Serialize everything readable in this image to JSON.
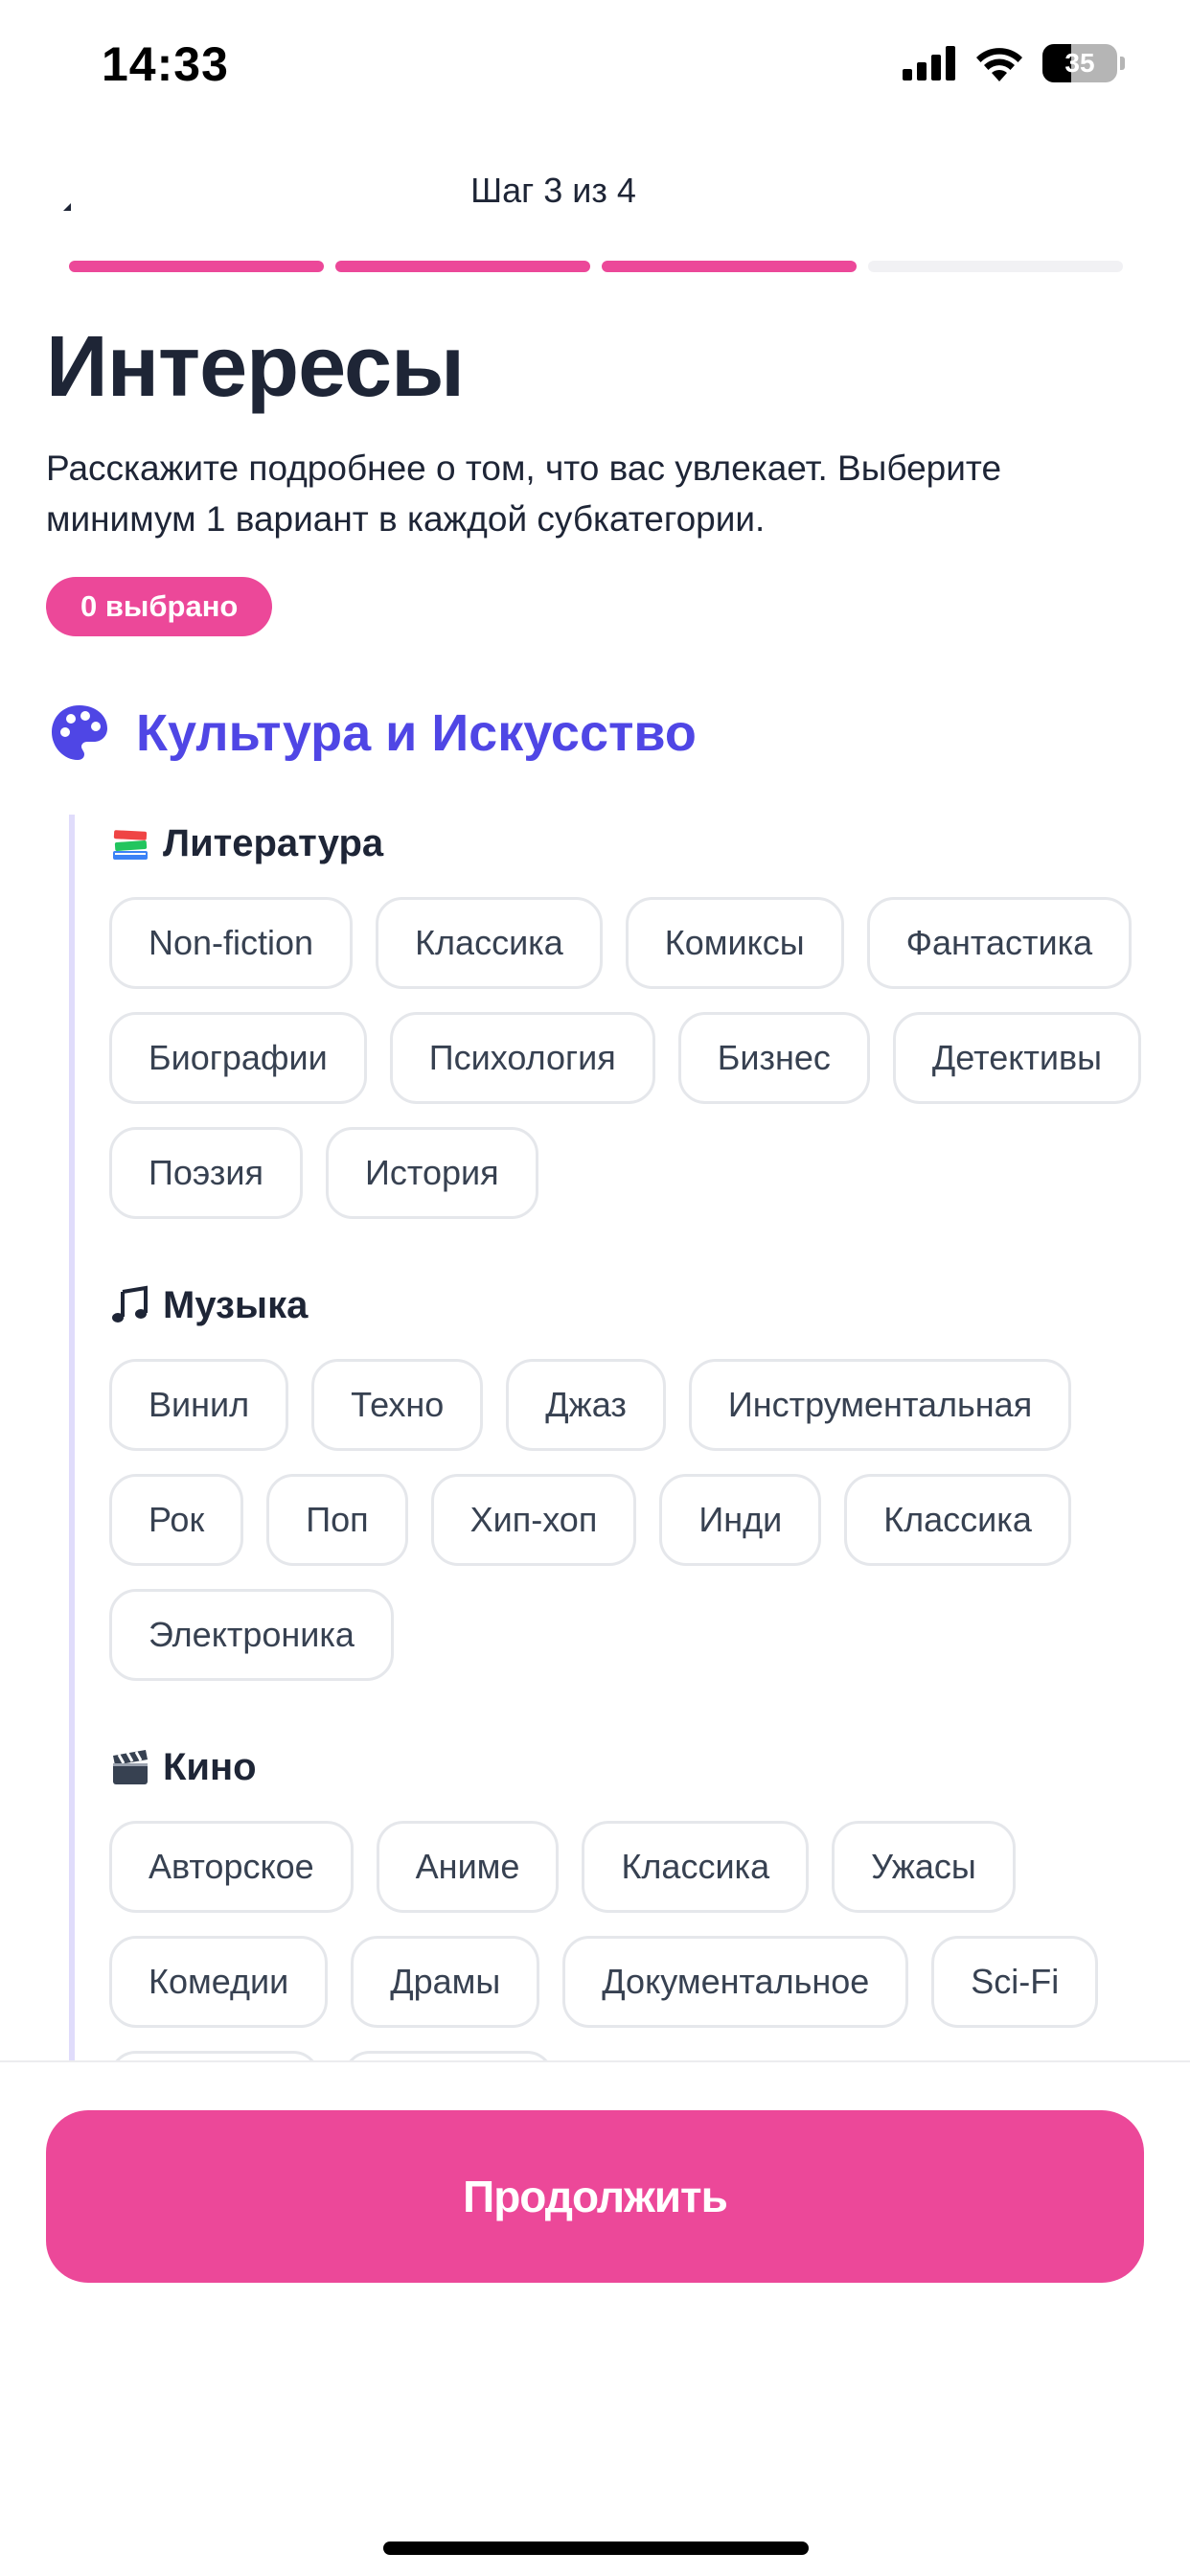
{
  "status_bar": {
    "time": "14:33",
    "battery": "35"
  },
  "header": {
    "step_label": "Шаг 3 из 4",
    "total_steps": 4,
    "completed_steps": 3
  },
  "page": {
    "title": "Интересы",
    "description": "Расскажите подробнее о том, что вас увлекает. Выберите минимум 1 вариант в каждой субкатегории.",
    "selected_count_label": "0 выбрано"
  },
  "category": {
    "title": "Культура и Искусство",
    "icon": "palette-icon",
    "accent": "#4f46e5"
  },
  "subcategories": [
    {
      "title": "Литература",
      "icon": "books-icon",
      "options": [
        "Non-fiction",
        "Классика",
        "Комиксы",
        "Фантастика",
        "Биографии",
        "Психология",
        "Бизнес",
        "Детективы",
        "Поэзия",
        "История"
      ]
    },
    {
      "title": "Музыка",
      "icon": "music-note-icon",
      "options": [
        "Винил",
        "Техно",
        "Джаз",
        "Инструментальная",
        "Рок",
        "Поп",
        "Хип-хоп",
        "Инди",
        "Классика",
        "Электроника"
      ]
    },
    {
      "title": "Кино",
      "icon": "clapperboard-icon",
      "options": [
        "Авторское",
        "Аниме",
        "Классика",
        "Ужасы",
        "Комедии",
        "Драмы",
        "Документальное",
        "Sci-Fi"
      ]
    }
  ],
  "footer": {
    "continue_label": "Продолжить"
  },
  "colors": {
    "primary": "#ec4899",
    "text": "#1e2536",
    "chip_border": "#e5e7eb"
  }
}
